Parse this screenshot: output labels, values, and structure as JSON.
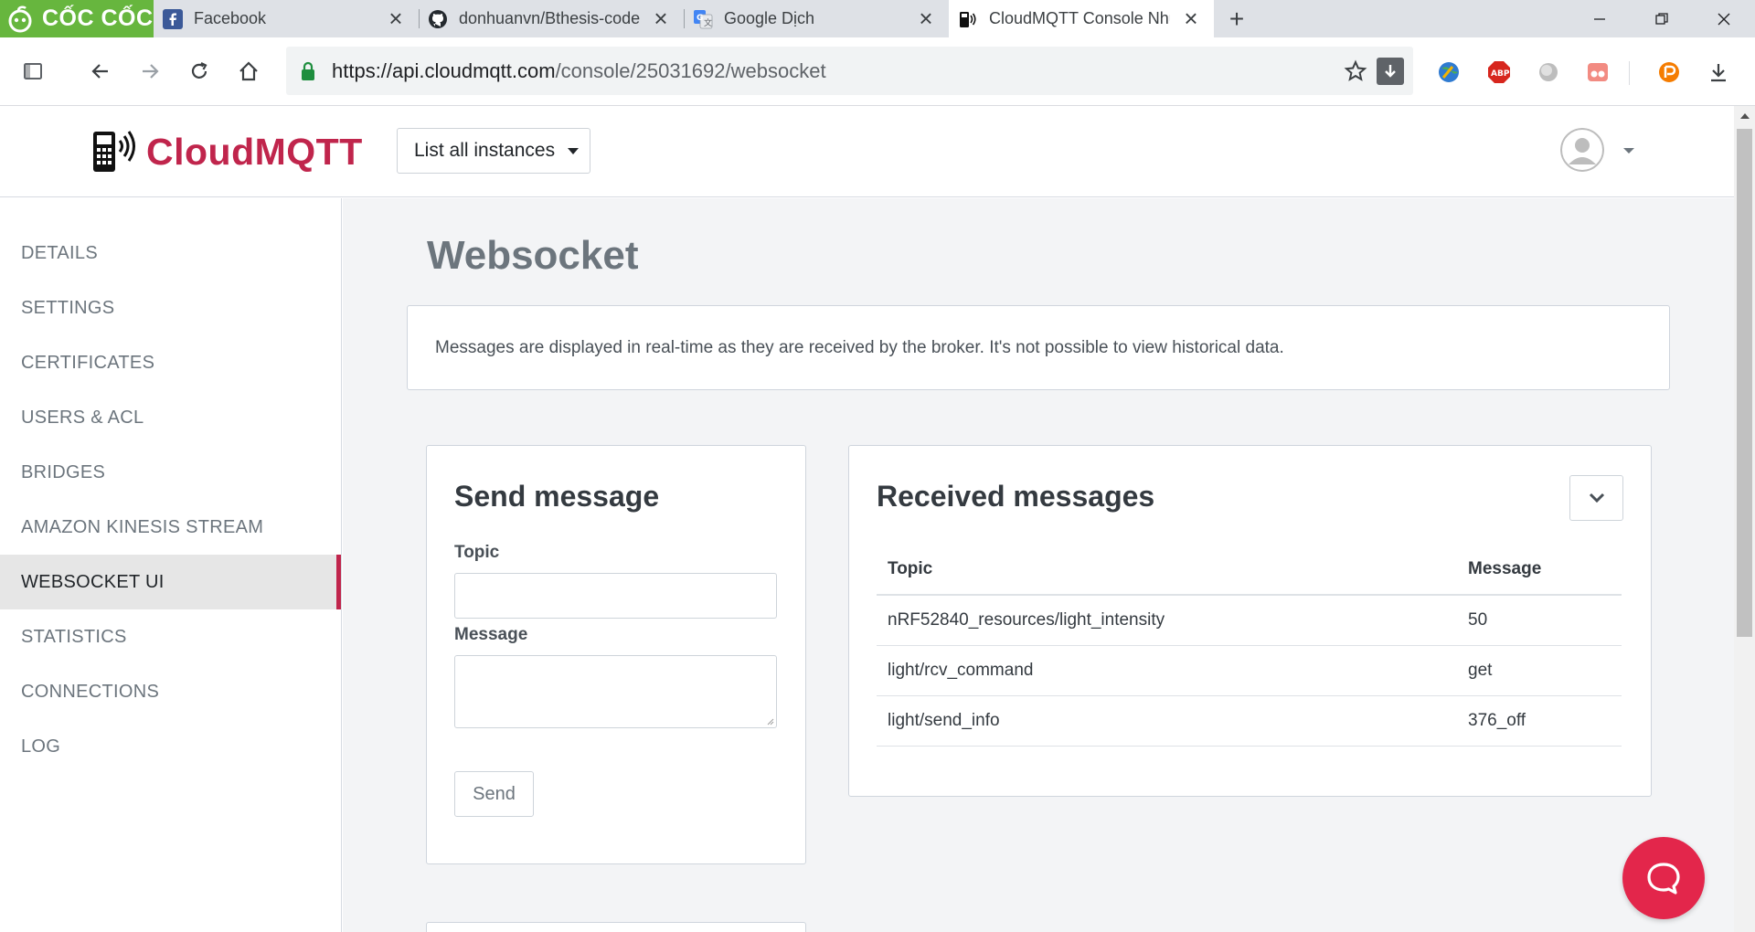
{
  "browser": {
    "brand": "CỐC CỐC",
    "tabs": [
      {
        "title": "Facebook",
        "icon": "facebook-icon"
      },
      {
        "title": "donhuanvn/Bthesis-code",
        "icon": "github-icon"
      },
      {
        "title": "Google Dịch",
        "icon": "google-translate-icon"
      },
      {
        "title": "CloudMQTT Console Nhu",
        "icon": "cloudmqtt-icon",
        "active": true
      }
    ],
    "url_host": "https://api.cloudmqtt.com",
    "url_path": "/console/25031692/websocket",
    "extensions": [
      "download-manager-icon",
      "earth-extension-icon",
      "adblock-plus-icon",
      "globe-extension-icon",
      "todo-extension-icon",
      "idm-extension-icon",
      "download-icon"
    ]
  },
  "header": {
    "logo_text": "CloudMQTT",
    "instances_button": "List all instances"
  },
  "sidebar": {
    "items": [
      {
        "label": "DETAILS"
      },
      {
        "label": "SETTINGS"
      },
      {
        "label": "CERTIFICATES"
      },
      {
        "label": "USERS & ACL"
      },
      {
        "label": "BRIDGES"
      },
      {
        "label": "AMAZON KINESIS STREAM"
      },
      {
        "label": "WEBSOCKET UI",
        "active": true
      },
      {
        "label": "STATISTICS"
      },
      {
        "label": "CONNECTIONS"
      },
      {
        "label": "LOG"
      }
    ]
  },
  "main": {
    "title": "Websocket",
    "info": "Messages are displayed in real-time as they are received by the broker. It's not possible to view historical data.",
    "send": {
      "heading": "Send message",
      "topic_label": "Topic",
      "topic_value": "",
      "message_label": "Message",
      "message_value": "",
      "send_label": "Send"
    },
    "received": {
      "heading": "Received messages",
      "columns": [
        "Topic",
        "Message"
      ],
      "rows": [
        {
          "topic": "nRF52840_resources/light_intensity",
          "message": "50"
        },
        {
          "topic": "light/rcv_command",
          "message": "get"
        },
        {
          "topic": "light/send_info",
          "message": "376_off"
        }
      ]
    }
  },
  "colors": {
    "brand": "#c0254c",
    "coccoc_green": "#67b63e",
    "chat": "#e3264b"
  }
}
